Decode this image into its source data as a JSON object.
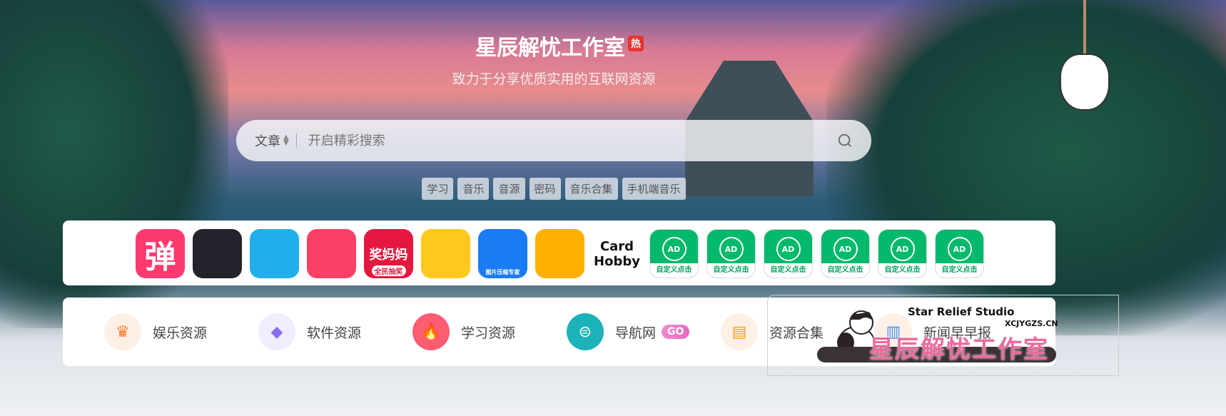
{
  "header": {
    "title": "星辰解忧工作室",
    "hot_badge": "热",
    "subtitle": "致力于分享优质实用的互联网资源"
  },
  "search": {
    "type_label": "文章",
    "placeholder": "开启精彩搜索"
  },
  "tags": [
    "学习",
    "音乐",
    "音源",
    "密码",
    "音乐合集",
    "手机端音乐"
  ],
  "apps": [
    {
      "name": "弹",
      "color": "#fd3a6f"
    },
    {
      "name": "bilibili-tv",
      "color": "#23232b"
    },
    {
      "name": "bilibili",
      "color": "#22aeea"
    },
    {
      "name": "wheel",
      "color": "#fb4065"
    },
    {
      "name": "奖妈妈",
      "sub": "全民抽奖",
      "color": "#e6173f"
    },
    {
      "name": "duck",
      "color": "#ffc81e"
    },
    {
      "name": "图片压缩专家",
      "color": "#1a7cf5"
    },
    {
      "name": "cloud",
      "color": "#ffb000"
    },
    {
      "name": "Card Hobby",
      "color": "#ffffff"
    }
  ],
  "ads": {
    "icon_text": "AD",
    "label": "自定义点击",
    "count": 6
  },
  "categories": [
    {
      "label": "娱乐资源",
      "icon": "crown-icon",
      "bg": "#fff0e6",
      "color": "#ff7a2c"
    },
    {
      "label": "软件资源",
      "icon": "diamond-icon",
      "bg": "#eeeeff",
      "color": "#8a6cf0"
    },
    {
      "label": "学习资源",
      "icon": "flame-icon",
      "bg": "#fd5c72",
      "color": "#ffffff"
    },
    {
      "label": "导航网",
      "icon": "compass-icon",
      "bg": "#1bb3b8",
      "color": "#ffffff",
      "badge": "GO"
    },
    {
      "label": "资源合集",
      "icon": "chat-icon",
      "bg": "#fff0e6",
      "color": "#ff9a1c"
    },
    {
      "label": "新闻早早报",
      "icon": "book-icon",
      "bg": "#fff0e6",
      "color": "#3d8ff0"
    }
  ],
  "banner": {
    "en": "Star Relief Studio",
    "url": "XCJYGZS.CN",
    "cn": "星辰解忧工作室"
  }
}
